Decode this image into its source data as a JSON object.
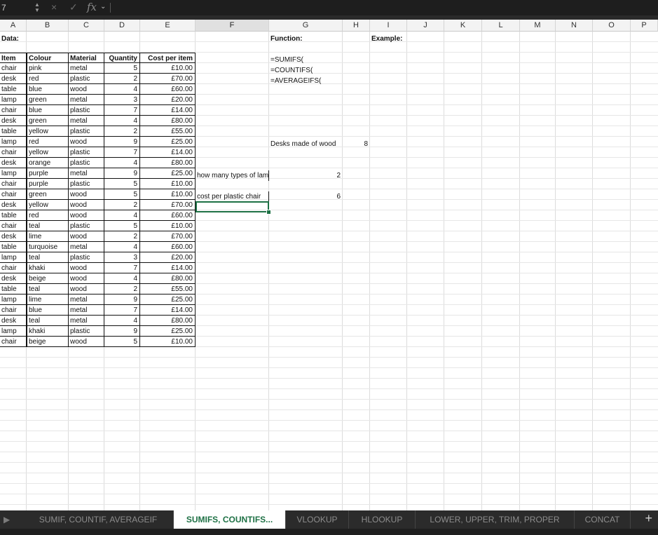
{
  "formula_bar": {
    "name_box": "7",
    "fx_label": "fx",
    "cancel_icon": "×",
    "confirm_icon": "✓"
  },
  "columns": [
    "A",
    "B",
    "C",
    "D",
    "E",
    "F",
    "G",
    "H",
    "I",
    "J",
    "K",
    "L",
    "M",
    "N",
    "O",
    "P"
  ],
  "selected_column": "F",
  "labels": {
    "data": "Data:",
    "function": "Function:",
    "example": "Example:"
  },
  "table_headers": [
    "Item",
    "Colour",
    "Material",
    "Quantity",
    "Cost per item"
  ],
  "table_rows": [
    [
      "chair",
      "pink",
      "metal",
      "5",
      "£10.00"
    ],
    [
      "desk",
      "red",
      "plastic",
      "2",
      "£70.00"
    ],
    [
      "table",
      "blue",
      "wood",
      "4",
      "£60.00"
    ],
    [
      "lamp",
      "green",
      "metal",
      "3",
      "£20.00"
    ],
    [
      "chair",
      "blue",
      "plastic",
      "7",
      "£14.00"
    ],
    [
      "desk",
      "green",
      "metal",
      "4",
      "£80.00"
    ],
    [
      "table",
      "yellow",
      "plastic",
      "2",
      "£55.00"
    ],
    [
      "lamp",
      "red",
      "wood",
      "9",
      "£25.00"
    ],
    [
      "chair",
      "yellow",
      "plastic",
      "7",
      "£14.00"
    ],
    [
      "desk",
      "orange",
      "plastic",
      "4",
      "£80.00"
    ],
    [
      "lamp",
      "purple",
      "metal",
      "9",
      "£25.00"
    ],
    [
      "chair",
      "purple",
      "plastic",
      "5",
      "£10.00"
    ],
    [
      "chair",
      "green",
      "wood",
      "5",
      "£10.00"
    ],
    [
      "desk",
      "yellow",
      "wood",
      "2",
      "£70.00"
    ],
    [
      "table",
      "red",
      "wood",
      "4",
      "£60.00"
    ],
    [
      "chair",
      "teal",
      "plastic",
      "5",
      "£10.00"
    ],
    [
      "desk",
      "lime",
      "wood",
      "2",
      "£70.00"
    ],
    [
      "table",
      "turquoise",
      "metal",
      "4",
      "£60.00"
    ],
    [
      "lamp",
      "teal",
      "plastic",
      "3",
      "£20.00"
    ],
    [
      "chair",
      "khaki",
      "wood",
      "7",
      "£14.00"
    ],
    [
      "desk",
      "beige",
      "wood",
      "4",
      "£80.00"
    ],
    [
      "table",
      "teal",
      "wood",
      "2",
      "£55.00"
    ],
    [
      "lamp",
      "lime",
      "metal",
      "9",
      "£25.00"
    ],
    [
      "chair",
      "blue",
      "metal",
      "7",
      "£14.00"
    ],
    [
      "desk",
      "teal",
      "metal",
      "4",
      "£80.00"
    ],
    [
      "lamp",
      "khaki",
      "plastic",
      "9",
      "£25.00"
    ],
    [
      "chair",
      "beige",
      "wood",
      "5",
      "£10.00"
    ]
  ],
  "functions": [
    "=SUMIFS(",
    "=COUNTIFS(",
    "=AVERAGEIFS("
  ],
  "examples": {
    "desks_wood_label": "Desks made of wood",
    "desks_wood_value": "8",
    "lamp_types_label": "how many types of lamp",
    "lamp_types_value": "2",
    "plastic_chair_label": "cost per plastic chair",
    "plastic_chair_value": "6"
  },
  "tabs": [
    {
      "label": "SUMIF, COUNTIF, AVERAGEIF",
      "active": false
    },
    {
      "label": "SUMIFS, COUNTIFS...",
      "active": true
    },
    {
      "label": "VLOOKUP",
      "active": false
    },
    {
      "label": "HLOOKUP",
      "active": false
    },
    {
      "label": "LOWER, UPPER, TRIM, PROPER",
      "active": false
    },
    {
      "label": "CONCAT",
      "active": false
    }
  ],
  "tab_add_icon": "+",
  "tab_scroll_icon": "▶",
  "colors": {
    "accent": "#1e7145",
    "chrome": "#2b2b2b"
  }
}
